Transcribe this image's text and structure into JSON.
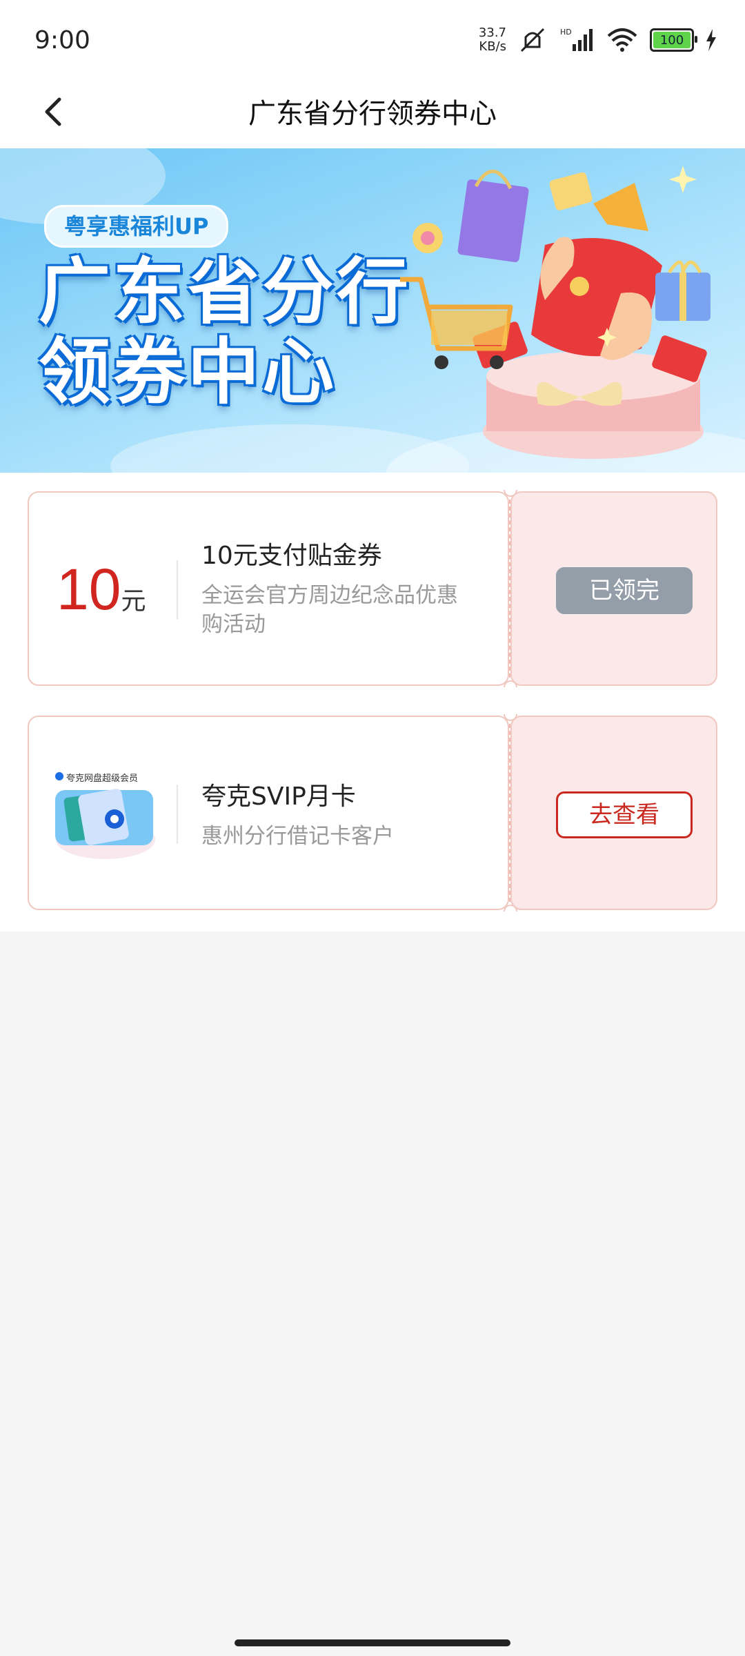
{
  "status_bar": {
    "time": "9:00",
    "net_speed": "33.7",
    "net_speed_unit": "KB/s",
    "battery": "100"
  },
  "header": {
    "title": "广东省分行领券中心"
  },
  "banner": {
    "tag": "粤享惠福利UP",
    "title_line1": "广东省分行",
    "title_line2": "领券中心"
  },
  "coupons": [
    {
      "amount": "10",
      "unit": "元",
      "title": "10元支付贴金券",
      "desc": "全运会官方周边纪念品优惠购活动",
      "button": "已领完"
    },
    {
      "logo_label": "夸克网盘超级会员",
      "title": "夸克SVIP月卡",
      "desc": "惠州分行借记卡客户",
      "button": "去查看"
    }
  ],
  "colors": {
    "accent_red": "#c9281f",
    "disabled_gray": "#949ea8",
    "coupon_pink": "#fbe8e8"
  }
}
